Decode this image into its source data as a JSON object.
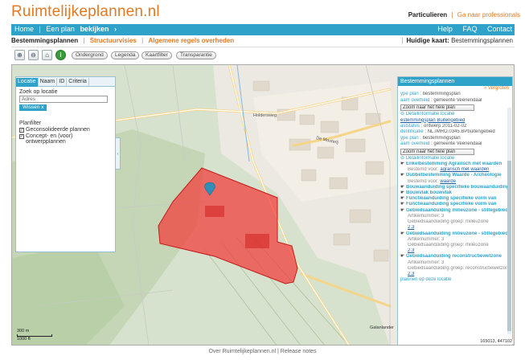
{
  "header": {
    "logo": "Ruimtelijkeplannen.nl",
    "particulieren": "Particulieren",
    "separator": "|",
    "pro_link": "Ga naar professionals"
  },
  "nav": {
    "home": "Home",
    "divider": "|",
    "plan_prefix": "Een plan",
    "plan_bold": "bekijken",
    "chevron": "›",
    "help": "Help",
    "faq": "FAQ",
    "contact": "Contact"
  },
  "tabs": {
    "bestemmingsplannen": "Bestemmingsplannen",
    "pipe": "|",
    "structuurvisies": "Structuurvisies",
    "algemene": "Algemene regels overheden",
    "huidige_label": "Huidige kaart:",
    "huidige_value": "Bestemmingsplannen"
  },
  "toolbar": {
    "zoom_in": "⊕",
    "zoom_out": "⊖",
    "home_icon": "⌂",
    "info": "i",
    "ondergrond": "Ondergrond",
    "legenda": "Legenda",
    "kaartfilter": "Kaartfilter",
    "transparantie": "Transparantie"
  },
  "left_panel": {
    "tabs": [
      "Locatie",
      "Naam",
      "ID",
      "Criteria"
    ],
    "search_label": "Zoek op locatie",
    "search_placeholder": "Adres",
    "wissen": "Wissen",
    "wissen_x": "x",
    "planfilter_label": "Planfilter",
    "check1": "Geconsolideerde plannen",
    "check2_line1": "Concept- en (voor)",
    "check2_line2": "ontwerpplannen",
    "handle": "‹"
  },
  "right_panel": {
    "title": "Bestemmingsplannen",
    "vergroten": "« Vergroten",
    "rows_top": [
      {
        "k": "ype plan",
        "v": ": bestemmingsplan"
      },
      {
        "k": "aam overheid",
        "v": ": gemeente Veenendaal"
      }
    ],
    "zoom1": "Zoom naar het hele plan",
    "detail1": "⊖ Detailinformatie locatie",
    "plan_link": "estemmingsplan Buitengebied",
    "rows_mid": [
      {
        "k": "aststatus",
        "v": ": ontwerp 2011-02-02"
      },
      {
        "k": "dentificatie",
        "v": ": NL.IMRO.0345.BPbuitengebied"
      },
      {
        "k": "ype plan",
        "v": ": bestemmingsplan"
      },
      {
        "k": "aam overheid",
        "v": ": gemeente Veenendaal"
      }
    ],
    "zoom2": "Zoom naar het hele plan",
    "detail2": "⊖ Detailinformatie locatie",
    "items": [
      {
        "title": "Enkelbestemming Agrarisch met waarden",
        "sub": "Bestemd voor:",
        "val": "agrarisch met waarden"
      },
      {
        "title": "Dubbelbestemming Waarde - Archeologie",
        "sub": "Bestemd voor:",
        "val": "waarde"
      },
      {
        "title": "Bouwaanduiding specifieke bouwaanduiding",
        "sub": "",
        "val": ""
      },
      {
        "title": "Bouwvlak bouwvlak",
        "sub": "",
        "val": ""
      },
      {
        "title": "Functieaanduiding specifieke vorm van",
        "sub": "",
        "val": ""
      },
      {
        "title": "Functieaanduiding specifieke vorm van",
        "sub": "",
        "val": ""
      },
      {
        "title": "Gebiedsaanduiding milieuzone - stiltegebied",
        "sub": "Artikelnummer: 3",
        "sub2": "Gebiedsaanduiding groep: milieuzone",
        "val": "2.3"
      },
      {
        "title": "Gebiedsaanduiding milieuzone - stiltegebied",
        "sub": "Artikelnummer: 3",
        "sub2": "Gebiedsaanduiding groep: milieuzone",
        "val": "2.3"
      },
      {
        "title": "Gebiedsaanduiding reconstructiewetzone",
        "sub": "Artikelnummer: 3",
        "sub2": "Gebiedsaanduiding groep: reconstructiewetzone",
        "val": "2.3"
      }
    ],
    "bottom_link": "plannen op deze locatie"
  },
  "map": {
    "label_holdersweg": "Holdersweg",
    "label_de_mouterij": "De Mouterij",
    "label_galanlander": "Galanlander",
    "scale_top": "300 m",
    "scale_bottom": "1000 ft",
    "coords": "165013, 447102",
    "highlight_color": "#f23a3a"
  },
  "footer": {
    "text": "Over Ruimtelijkeplannen.nl | Release notes"
  }
}
